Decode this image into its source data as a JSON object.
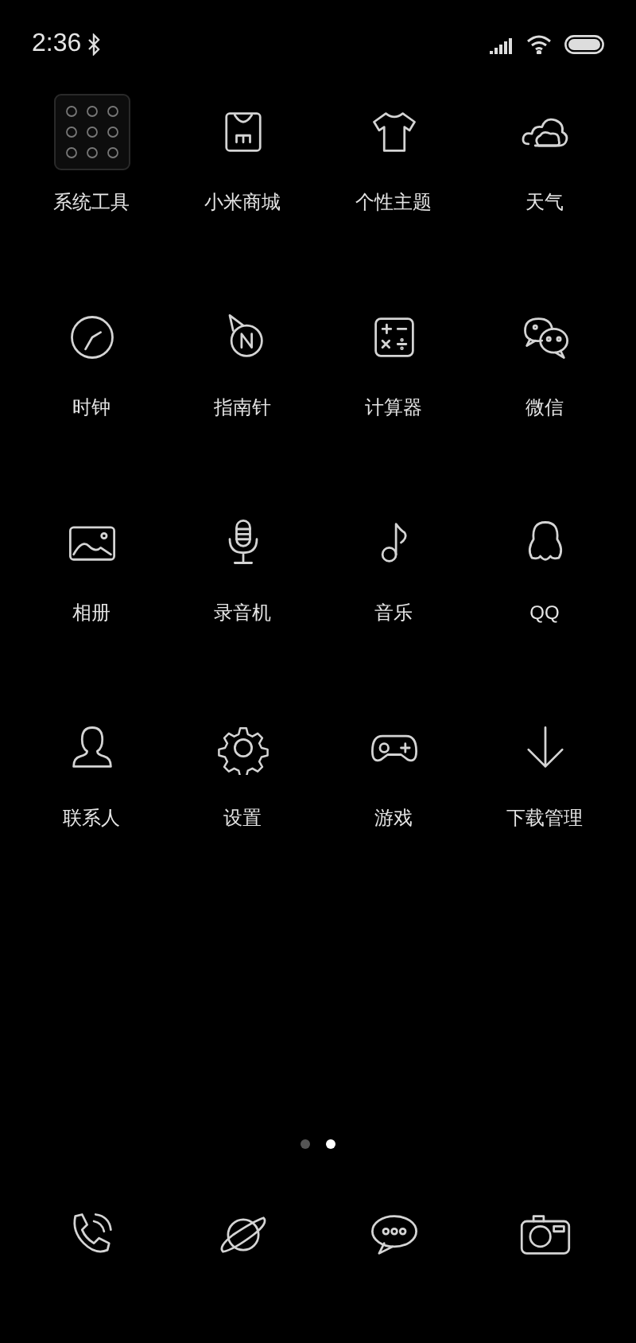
{
  "status_bar": {
    "time": "2:36"
  },
  "apps": [
    {
      "label": "系统工具"
    },
    {
      "label": "小米商城"
    },
    {
      "label": "个性主题"
    },
    {
      "label": "天气"
    },
    {
      "label": "时钟"
    },
    {
      "label": "指南针"
    },
    {
      "label": "计算器"
    },
    {
      "label": "微信"
    },
    {
      "label": "相册"
    },
    {
      "label": "录音机"
    },
    {
      "label": "音乐"
    },
    {
      "label": "QQ"
    },
    {
      "label": "联系人"
    },
    {
      "label": "设置"
    },
    {
      "label": "游戏"
    },
    {
      "label": "下载管理"
    }
  ],
  "page_dots": [
    {
      "selected": false
    },
    {
      "selected": true
    }
  ]
}
